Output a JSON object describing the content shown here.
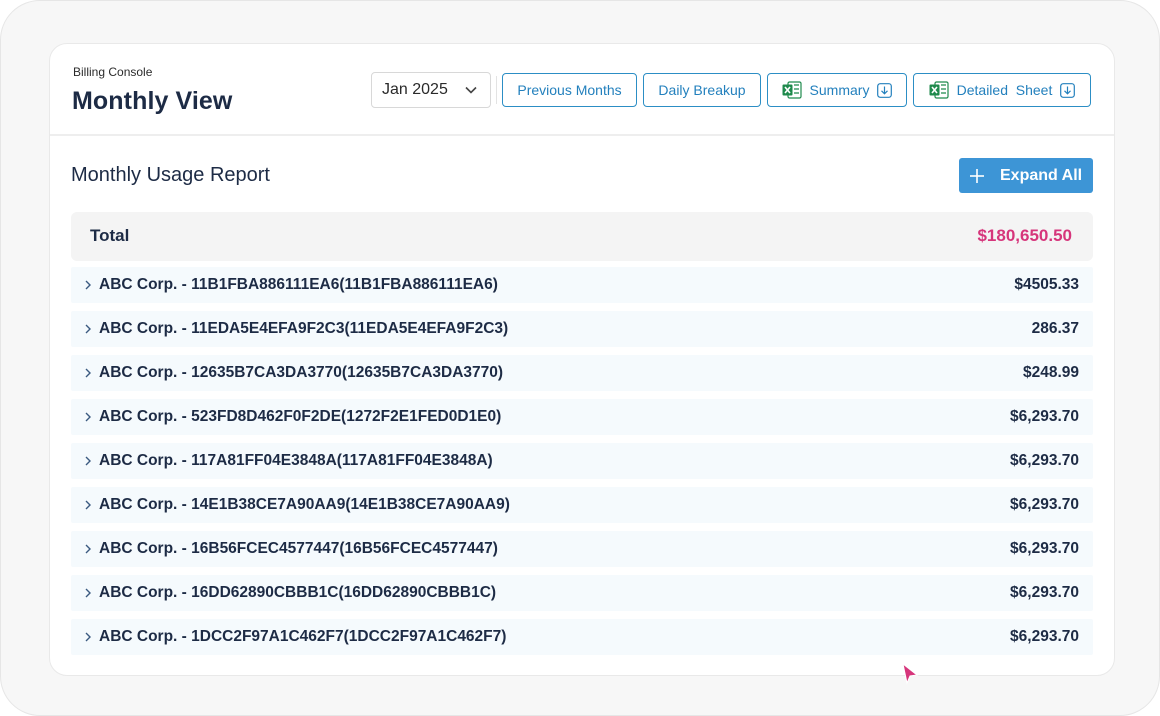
{
  "header": {
    "breadcrumb": "Billing Console",
    "title": "Monthly View",
    "month_select": {
      "value": "Jan 2025",
      "icon": "chevron-down-icon"
    },
    "buttons": {
      "previous_months": "Previous Months",
      "daily_breakup": "Daily Breakup",
      "summary": "Summary",
      "detailed_sheet": "Detailed  Sheet"
    },
    "icons": {
      "excel": "excel-icon",
      "download": "download-icon"
    }
  },
  "report": {
    "title": "Monthly Usage Report",
    "expand_all": "Expand All",
    "total_label": "Total",
    "total_amount": "$180,650.50",
    "rows": [
      {
        "name": "ABC Corp. - 11B1FBA886111EA6(11B1FBA886111EA6)",
        "amount": "$4505.33"
      },
      {
        "name": "ABC Corp. - 11EDA5E4EFA9F2C3(11EDA5E4EFA9F2C3)",
        "amount": "286.37"
      },
      {
        "name": "ABC Corp. - 12635B7CA3DA3770(12635B7CA3DA3770)",
        "amount": "$248.99"
      },
      {
        "name": "ABC Corp. - 523FD8D462F0F2DE(1272F2E1FED0D1E0)",
        "amount": "$6,293.70"
      },
      {
        "name": "ABC Corp. - 117A81FF04E3848A(117A81FF04E3848A)",
        "amount": "$6,293.70"
      },
      {
        "name": "ABC Corp. - 14E1B38CE7A90AA9(14E1B38CE7A90AA9)",
        "amount": "$6,293.70"
      },
      {
        "name": "ABC Corp. - 16B56FCEC4577447(16B56FCEC4577447)",
        "amount": "$6,293.70"
      },
      {
        "name": "ABC Corp. - 16DD62890CBBB1C(16DD62890CBBB1C)",
        "amount": "$6,293.70"
      },
      {
        "name": "ABC Corp. - 1DCC2F97A1C462F7(1DCC2F97A1C462F7)",
        "amount": "$6,293.70"
      }
    ]
  },
  "colors": {
    "accent": "#2c8ec5",
    "primary_button": "#3d95d6",
    "total_amount": "#d6357b",
    "text_dark": "#1d2b45",
    "excel_green": "#1f8a4c"
  }
}
